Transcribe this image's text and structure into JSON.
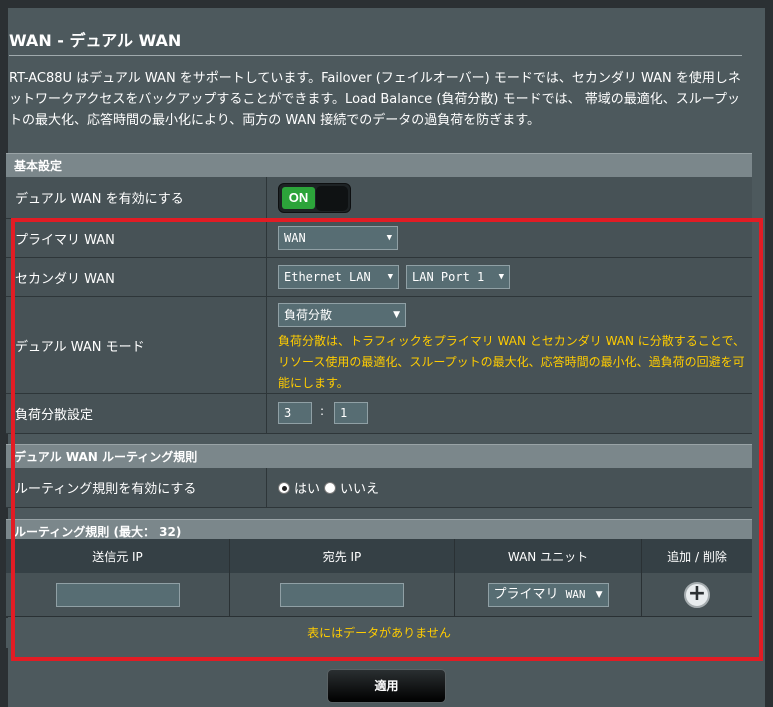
{
  "page": {
    "title": "WAN - デュアル WAN",
    "description": "RT-AC88U はデュアル WAN をサポートしています。Failover (フェイルオーバー) モードでは、セカンダリ WAN を使用しネットワークアクセスをバックアップすることができます。Load Balance (負荷分散) モードでは、 帯域の最適化、スループットの最大化、応答時間の最小化により、両方の WAN 接続でのデータの過負荷を防ぎます。"
  },
  "basic": {
    "header": "基本設定",
    "enable_label": "デュアル WAN を有効にする",
    "toggle_state": "ON",
    "primary_label": "プライマリ WAN",
    "primary_value": "WAN",
    "secondary_label": "セカンダリ WAN",
    "secondary_value": "Ethernet LAN",
    "secondary_port": "LAN Port 1",
    "mode_label": "デュアル WAN モード",
    "mode_value": "負荷分散",
    "mode_note": "負荷分散は、トラフィックをプライマリ WAN とセカンダリ WAN に分散することで、リソース使用の最適化、スループットの最大化、応答時間の最小化、過負荷の回避を可能にします。",
    "lb_label": "負荷分散設定",
    "lb_primary": "3",
    "lb_secondary": "1",
    "lb_separator": ":"
  },
  "routing": {
    "header": "デュアル WAN ルーティング規則",
    "enable_label": "ルーティング規則を有効にする",
    "yes_label": "はい",
    "no_label": "いいえ",
    "selected": "はい"
  },
  "rules": {
    "header": "ルーティング規則 (最大： 32)",
    "columns": [
      "送信元 IP",
      "宛先 IP",
      "WAN ユニット",
      "追加 / 削除"
    ],
    "unit_value": "プライマリ",
    "unit_suffix": "WAN",
    "empty_message": "表にはデータがありません"
  },
  "apply_label": "適用",
  "colors": {
    "accent_red": "#e21c24",
    "toggle_green": "#2ca43a",
    "note_yellow": "#ffcc00"
  }
}
